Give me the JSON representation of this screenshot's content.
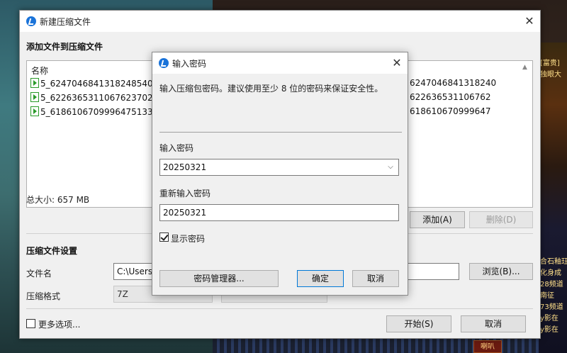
{
  "main_window": {
    "title": "新建压缩文件",
    "add_files_heading": "添加文件到压缩文件",
    "file_list": {
      "column_name": "名称",
      "files": [
        {
          "name": "5_6247046841318248540.MP",
          "name_right": "6247046841318240"
        },
        {
          "name": "5_6226365311067623702.MP",
          "name_right": "622636531106762"
        },
        {
          "name": "5_6186106709996475133.MP",
          "name_right": "618610670999647"
        }
      ]
    },
    "total_size": "总大小: 657 MB",
    "add_button": "添加(A)",
    "delete_button": "删除(D)",
    "settings_heading": "压缩文件设置",
    "filename_label": "文件名",
    "filename_value": "C:\\Users\\",
    "browse_button": "浏览(B)...",
    "format_label": "压缩格式",
    "format_value": "7Z",
    "more_options_label": "更多选项...",
    "start_button": "开始(S)",
    "cancel_button": "取消"
  },
  "password_dialog": {
    "title": "输入密码",
    "message": "输入压缩包密码。建议使用至少 8 位的密码来保证安全性。",
    "password_label": "输入密码",
    "password_value": "20250321",
    "confirm_label": "重新输入密码",
    "confirm_value": "20250321",
    "show_password_label": "显示密码",
    "show_password_checked": true,
    "manager_button": "密码管理器...",
    "ok_button": "确定",
    "cancel_button": "取消"
  },
  "background": {
    "game_texts": [
      "[富贵]",
      "独眼大",
      "合石釉珏",
      "化身成",
      "28频道",
      "南征",
      "73频道",
      "y影在",
      "y影在"
    ],
    "horn_button": "喇叭"
  }
}
